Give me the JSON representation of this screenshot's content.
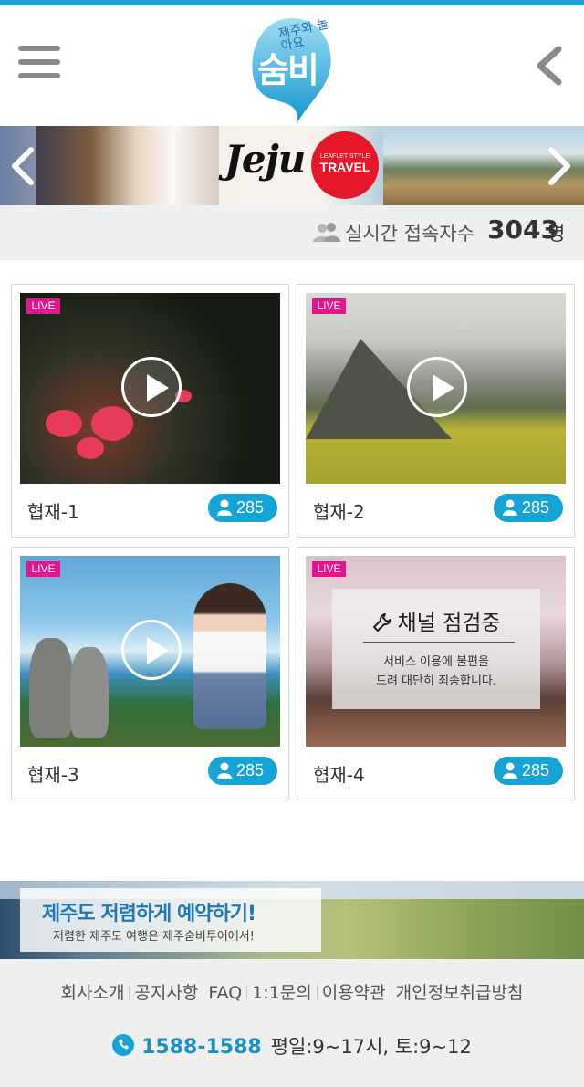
{
  "header": {
    "logo_small": "제주와 놀아요",
    "logo_main": "숨비",
    "menu_icon": "hamburger-menu-icon",
    "back_icon": "chevron-left-icon"
  },
  "banner": {
    "jeju_text": "Jeju",
    "badge_top": "LEAFLET STYLE",
    "badge_main": "TRAVEL"
  },
  "visitors": {
    "label": "실시간 접속자수",
    "count": "3043",
    "unit": "명"
  },
  "channels": [
    {
      "title": "협재-1",
      "live": "LIVE",
      "viewers": "285"
    },
    {
      "title": "협재-2",
      "live": "LIVE",
      "viewers": "285"
    },
    {
      "title": "협재-3",
      "live": "LIVE",
      "viewers": "285"
    },
    {
      "title": "협재-4",
      "live": "LIVE",
      "viewers": "285"
    }
  ],
  "maintenance": {
    "title": "채널 점검중",
    "line1": "서비스 이용에 불편을",
    "line2": "드려 대단히 죄송합니다."
  },
  "promo": {
    "title": "제주도 저렴하게 예약하기!",
    "subtitle": "저렴한 제주도 여행은 제주숨비투어에서!"
  },
  "footer": {
    "links": [
      "회사소개",
      "공지사항",
      "FAQ",
      "1:1문의",
      "이용약관",
      "개인정보취급방침"
    ],
    "phone": "1588-1588",
    "hours": "평일:9~17시, 토:9~12"
  },
  "colors": {
    "accent": "#16a4d6",
    "live_badge": "#e6158d",
    "footer_bg": "#efefef"
  }
}
